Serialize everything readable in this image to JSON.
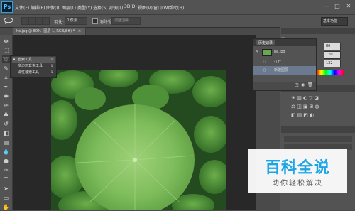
{
  "app": {
    "logo": "Ps"
  },
  "menus": [
    "文件(F)",
    "编辑(E)",
    "图像(I)",
    "图层(L)",
    "类型(Y)",
    "选择(S)",
    "滤镜(T)",
    "3D(D)",
    "视图(V)",
    "窗口(W)",
    "帮助(H)"
  ],
  "window_controls": [
    "—",
    "□",
    "✕"
  ],
  "options": {
    "feather_label": "羽化:",
    "feather_value": "0 像素",
    "antialias_label": "消除锯齿",
    "refine_button": "调整边缘..."
  },
  "workspace": {
    "label": "基本功能"
  },
  "document": {
    "tab": "he.jpg @ 80% (图层 1, RGB/8#) *",
    "close": "×"
  },
  "flyout": {
    "items": [
      {
        "label": "套索工具",
        "key": "L"
      },
      {
        "label": "多边形套索工具",
        "key": "L"
      },
      {
        "label": "磁性套索工具",
        "key": "L"
      }
    ]
  },
  "history": {
    "tab": "历史记录",
    "items": [
      {
        "label": "he.jpg"
      },
      {
        "label": "打开"
      },
      {
        "label": "新建图层"
      }
    ]
  },
  "color_values": [
    "86",
    "170",
    "132"
  ],
  "watermark": {
    "title": "百科全说",
    "subtitle": "助你轻松解决"
  },
  "colors": {
    "chrome": "#535353",
    "canvas": "#282828",
    "accent": "#1aa5e6"
  }
}
